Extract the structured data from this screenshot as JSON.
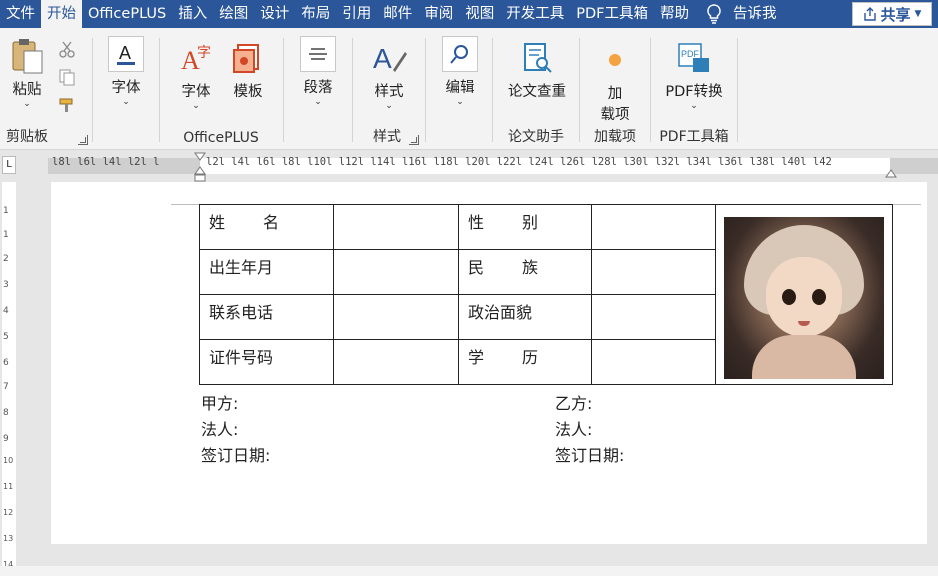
{
  "tabs": [
    {
      "label": "文件"
    },
    {
      "label": "开始",
      "active": true
    },
    {
      "label": "OfficePLUS"
    },
    {
      "label": "插入"
    },
    {
      "label": "绘图"
    },
    {
      "label": "设计"
    },
    {
      "label": "布局"
    },
    {
      "label": "引用"
    },
    {
      "label": "邮件"
    },
    {
      "label": "审阅"
    },
    {
      "label": "视图"
    },
    {
      "label": "开发工具"
    },
    {
      "label": "PDF工具箱"
    },
    {
      "label": "帮助"
    }
  ],
  "tell_me": "告诉我",
  "share": "共享",
  "ribbon": {
    "clipboard": {
      "paste": "粘贴",
      "label": "剪贴板"
    },
    "font": {
      "label": "字体"
    },
    "officeplus": {
      "font": "字体",
      "template": "模板",
      "label": "OfficePLUS"
    },
    "paragraph": {
      "label": "段落"
    },
    "styles": {
      "button": "样式",
      "label": "样式"
    },
    "editing": {
      "label": "编辑"
    },
    "paper": {
      "button": "论文查重",
      "label": "论文助手"
    },
    "addins": {
      "button_line1": "加",
      "button_line2": "载项",
      "label": "加载项"
    },
    "pdf": {
      "button": "PDF转换",
      "label": "PDF工具箱"
    }
  },
  "ruler": {
    "left_text": "l8l l6l l4l l2l l",
    "right_text": "l2l l4l l6l l8l l10l l12l l14l l16l l18l l20l l22l l24l l26l l28l l30l l32l l34l l36l l38l l40l l42",
    "vertical": [
      "1",
      "1",
      "2",
      "3",
      "4",
      "5",
      "6",
      "7",
      "8",
      "9",
      "10",
      "11",
      "12",
      "13",
      "14"
    ]
  },
  "table": {
    "rows": [
      {
        "label1": [
          "姓",
          "名"
        ],
        "label2": [
          "性",
          "别"
        ]
      },
      {
        "label1": [
          "出生年月"
        ],
        "label2": [
          "民",
          "族"
        ]
      },
      {
        "label1": [
          "联系电话"
        ],
        "label2": [
          "政治面貌"
        ]
      },
      {
        "label1": [
          "证件号码"
        ],
        "label2": [
          "学",
          "历"
        ]
      }
    ]
  },
  "signature": {
    "left": [
      "甲方:",
      "法人:",
      "签订日期:"
    ],
    "right": [
      "乙方:",
      "法人:",
      "签订日期:"
    ]
  }
}
